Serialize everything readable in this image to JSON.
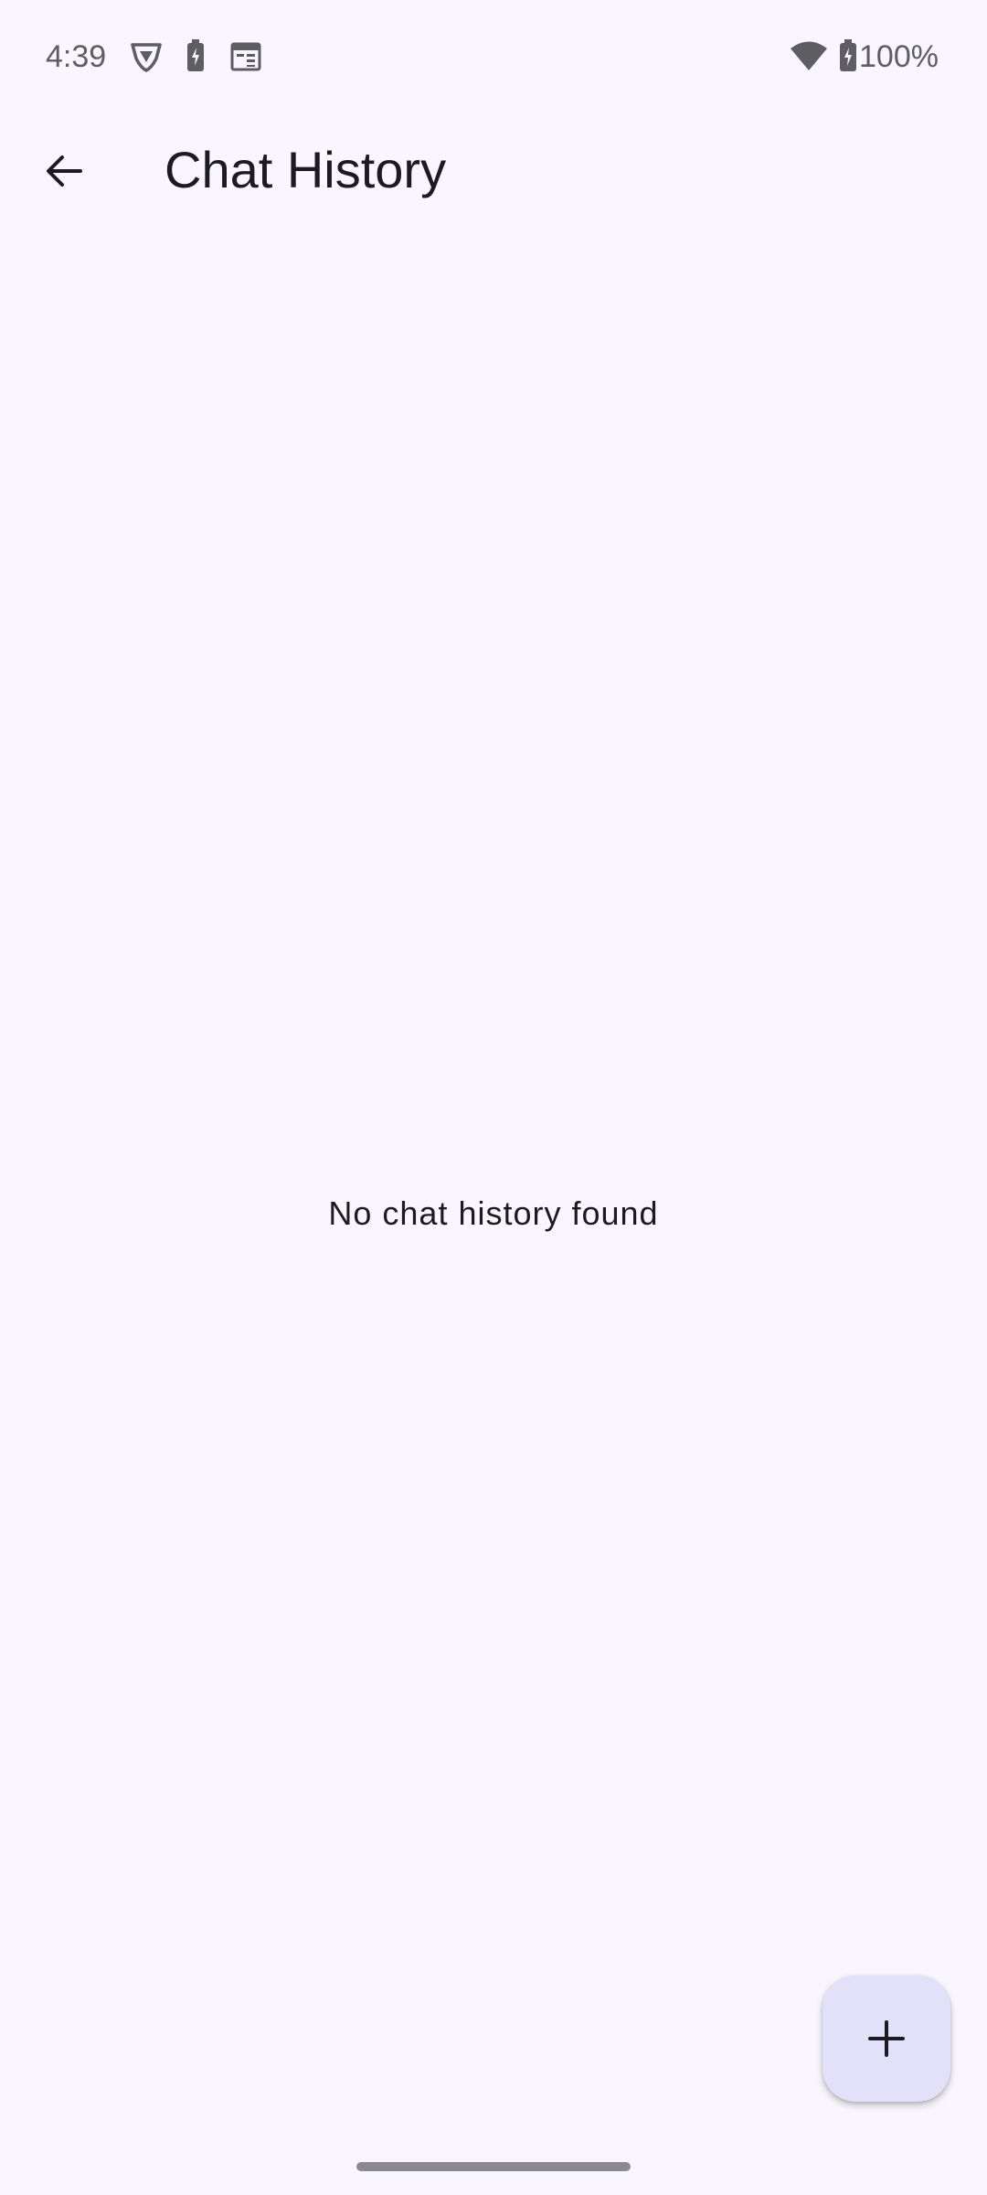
{
  "status_bar": {
    "time": "4:39",
    "battery_percent": "100%",
    "icons": [
      "shield-icon",
      "battery-saver-icon",
      "calendar-icon",
      "wifi-icon",
      "battery-charging-icon"
    ]
  },
  "app_bar": {
    "back_icon": "arrow-back-icon",
    "title": "Chat History"
  },
  "main": {
    "empty_message": "No chat history found"
  },
  "fab": {
    "icon": "plus-icon"
  },
  "colors": {
    "background": "#F9F7FD",
    "fab_background": "#E3E1F9",
    "text_primary": "#1C1B1F",
    "status_text": "#5E5E62"
  }
}
